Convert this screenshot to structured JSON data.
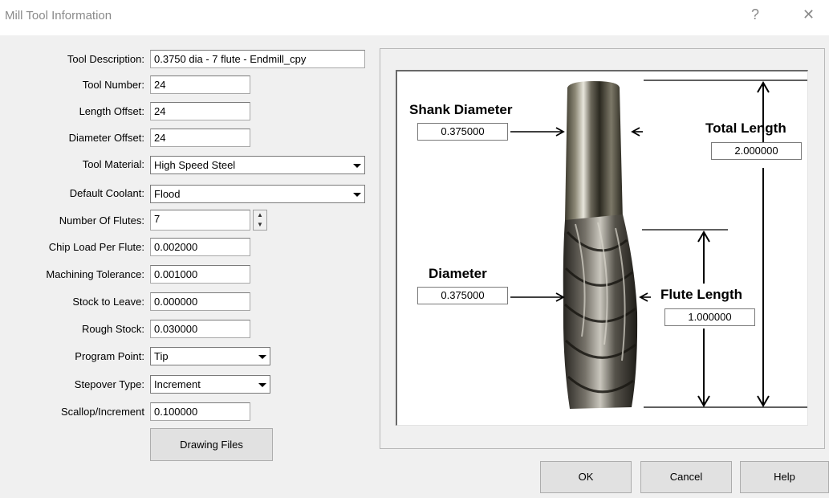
{
  "window": {
    "title": "Mill Tool Information",
    "help_glyph": "?",
    "close_glyph": "✕"
  },
  "form": {
    "tool_description": {
      "label": "Tool Description:",
      "value": "0.3750 dia - 7 flute - Endmill_cpy"
    },
    "tool_number": {
      "label": "Tool Number:",
      "value": "24"
    },
    "length_offset": {
      "label": "Length Offset:",
      "value": "24"
    },
    "diameter_offset": {
      "label": "Diameter Offset:",
      "value": "24"
    },
    "tool_material": {
      "label": "Tool Material:",
      "value": "High Speed Steel"
    },
    "default_coolant": {
      "label": "Default Coolant:",
      "value": "Flood"
    },
    "number_of_flutes": {
      "label": "Number Of Flutes:",
      "value": "7",
      "up_glyph": "▲",
      "down_glyph": "▼"
    },
    "chip_load": {
      "label": "Chip Load Per Flute:",
      "value": "0.002000"
    },
    "machining_tolerance": {
      "label": "Machining Tolerance:",
      "value": "0.001000"
    },
    "stock_to_leave": {
      "label": "Stock to Leave:",
      "value": "0.000000"
    },
    "rough_stock": {
      "label": "Rough Stock:",
      "value": "0.030000"
    },
    "program_point": {
      "label": "Program Point:",
      "value": "Tip"
    },
    "stepover_type": {
      "label": "Stepover Type:",
      "value": "Increment"
    },
    "scallop_increment": {
      "label": "Scallop/Increment",
      "value": "0.100000"
    },
    "drawing_files_label": "Drawing Files"
  },
  "diagram": {
    "shank_diameter": {
      "label": "Shank Diameter",
      "value": "0.375000"
    },
    "diameter": {
      "label": "Diameter",
      "value": "0.375000"
    },
    "total_length": {
      "label": "Total Length",
      "value": "2.000000"
    },
    "flute_length": {
      "label": "Flute Length",
      "value": "1.000000"
    }
  },
  "buttons": {
    "ok": "OK",
    "cancel": "Cancel",
    "help": "Help"
  },
  "colors": {
    "dialog_bg": "#f0f0f0",
    "title_text": "#8a8a8a",
    "button_bg": "#e1e1e1"
  }
}
